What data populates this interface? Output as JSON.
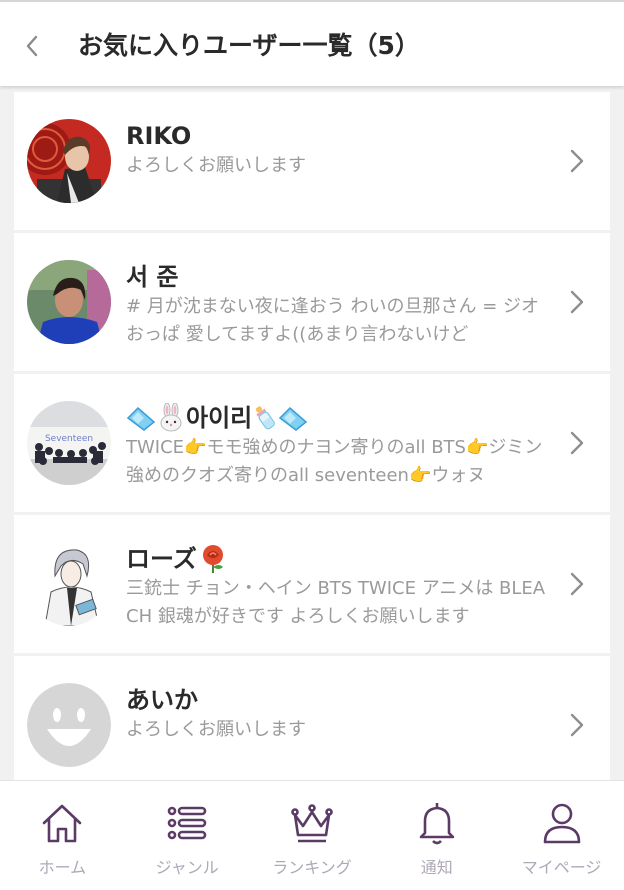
{
  "header": {
    "back_icon": "chevron-left-icon",
    "title": "お気に入りユーザー一覧（5）"
  },
  "users": [
    {
      "name": "RIKO",
      "bio": "よろしくお願いします",
      "avatar": "red-background-photo"
    },
    {
      "name": "서 준",
      "bio": "# 月が沈まない夜に逢おう わいの旦那さん = ジオおっぱ 愛してますよ((あまり言わないけど",
      "avatar": "blue-shirt-photo"
    },
    {
      "name": "아이리",
      "name_emojis": [
        "gem-icon",
        "rabbit-icon",
        "baby-bottle-icon",
        "gem-icon"
      ],
      "bio": "TWICE👉モモ強めのナヨン寄りのall BTS👉ジミン強めのクオズ寄りのall seventeen👉ウォヌ",
      "avatar": "group-photo"
    },
    {
      "name": "ローズ",
      "name_emojis": [
        "rose-icon"
      ],
      "bio": "三銃士 チョン・ヘイン BTS TWICE アニメは BLEACH 銀魂が好きです よろしくお願いします",
      "avatar": "anime-character-illustration"
    },
    {
      "name": "あいか",
      "bio": "よろしくお願いします",
      "avatar": "default-smiley-avatar"
    }
  ],
  "tabbar": [
    {
      "label": "ホーム",
      "icon": "home-icon"
    },
    {
      "label": "ジャンル",
      "icon": "list-icon"
    },
    {
      "label": "ランキング",
      "icon": "crown-icon"
    },
    {
      "label": "通知",
      "icon": "bell-icon"
    },
    {
      "label": "マイページ",
      "icon": "person-icon"
    }
  ],
  "colors": {
    "icon": "#5b3a66",
    "tab_label": "#b0a8b6",
    "background": "#f1f1f1"
  }
}
